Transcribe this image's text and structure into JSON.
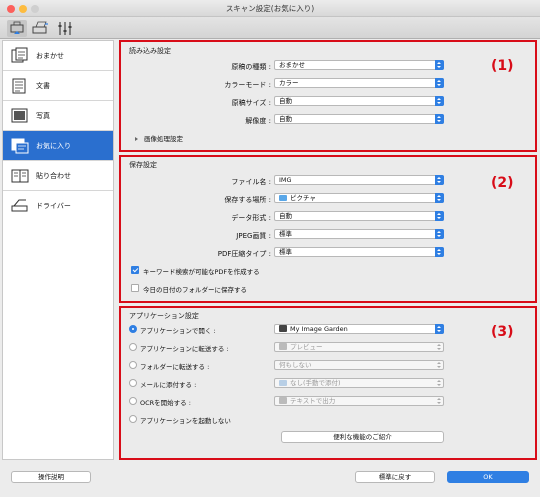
{
  "window": {
    "title": "スキャン設定(お気に入り)"
  },
  "sidebar": {
    "items": [
      {
        "label": "おまかせ",
        "icon": "auto-scan-icon",
        "selected": false
      },
      {
        "label": "文書",
        "icon": "document-icon",
        "selected": false
      },
      {
        "label": "写真",
        "icon": "photo-icon",
        "selected": false
      },
      {
        "label": "お気に入り",
        "icon": "favorite-icon",
        "selected": true
      },
      {
        "label": "貼り合わせ",
        "icon": "stitch-icon",
        "selected": false
      },
      {
        "label": "ドライバー",
        "icon": "driver-icon",
        "selected": false
      }
    ]
  },
  "scan_settings": {
    "title": "読み込み設定",
    "number": "(1)",
    "fields": [
      {
        "label": "原稿の種類 :",
        "value": "おまかせ"
      },
      {
        "label": "カラーモード :",
        "value": "カラー"
      },
      {
        "label": "原稿サイズ :",
        "value": "自動"
      },
      {
        "label": "解像度 :",
        "value": "自動"
      }
    ],
    "image_processing": "画像処理設定"
  },
  "save_settings": {
    "title": "保存設定",
    "number": "(2)",
    "fields": [
      {
        "label": "ファイル名 :",
        "value": "IMG"
      },
      {
        "label": "保存する場所 :",
        "value": "ピクチャ"
      },
      {
        "label": "データ形式 :",
        "value": "自動"
      },
      {
        "label": "JPEG画質 :",
        "value": "標準"
      },
      {
        "label": "PDF圧縮タイプ :",
        "value": "標準"
      }
    ],
    "checkboxes": [
      {
        "label": "キーワード検索が可能なPDFを作成する",
        "checked": true
      },
      {
        "label": "今日の日付のフォルダーに保存する",
        "checked": false
      }
    ]
  },
  "app_settings": {
    "title": "アプリケーション設定",
    "number": "(3)",
    "options": [
      {
        "label": "アプリケーションで開く :",
        "value": "My Image Garden",
        "selected": true
      },
      {
        "label": "アプリケーションに転送する :",
        "value": "プレビュー",
        "selected": false
      },
      {
        "label": "フォルダーに転送する :",
        "value": "何もしない",
        "selected": false
      },
      {
        "label": "メールに添付する :",
        "value": "なし(手動で添付)",
        "selected": false
      },
      {
        "label": "OCRを開始する :",
        "value": "テキストで出力",
        "selected": false
      },
      {
        "label": "アプリケーションを起動しない",
        "value": null,
        "selected": false
      }
    ],
    "more_functions": "便利な機能のご紹介"
  },
  "footer": {
    "help": "操作説明",
    "defaults": "標準に戻す",
    "ok": "OK"
  },
  "colors": {
    "accent": "#2f7fe3",
    "highlight_red": "#d80c18",
    "sidebar_selected": "#2a6fcf"
  }
}
